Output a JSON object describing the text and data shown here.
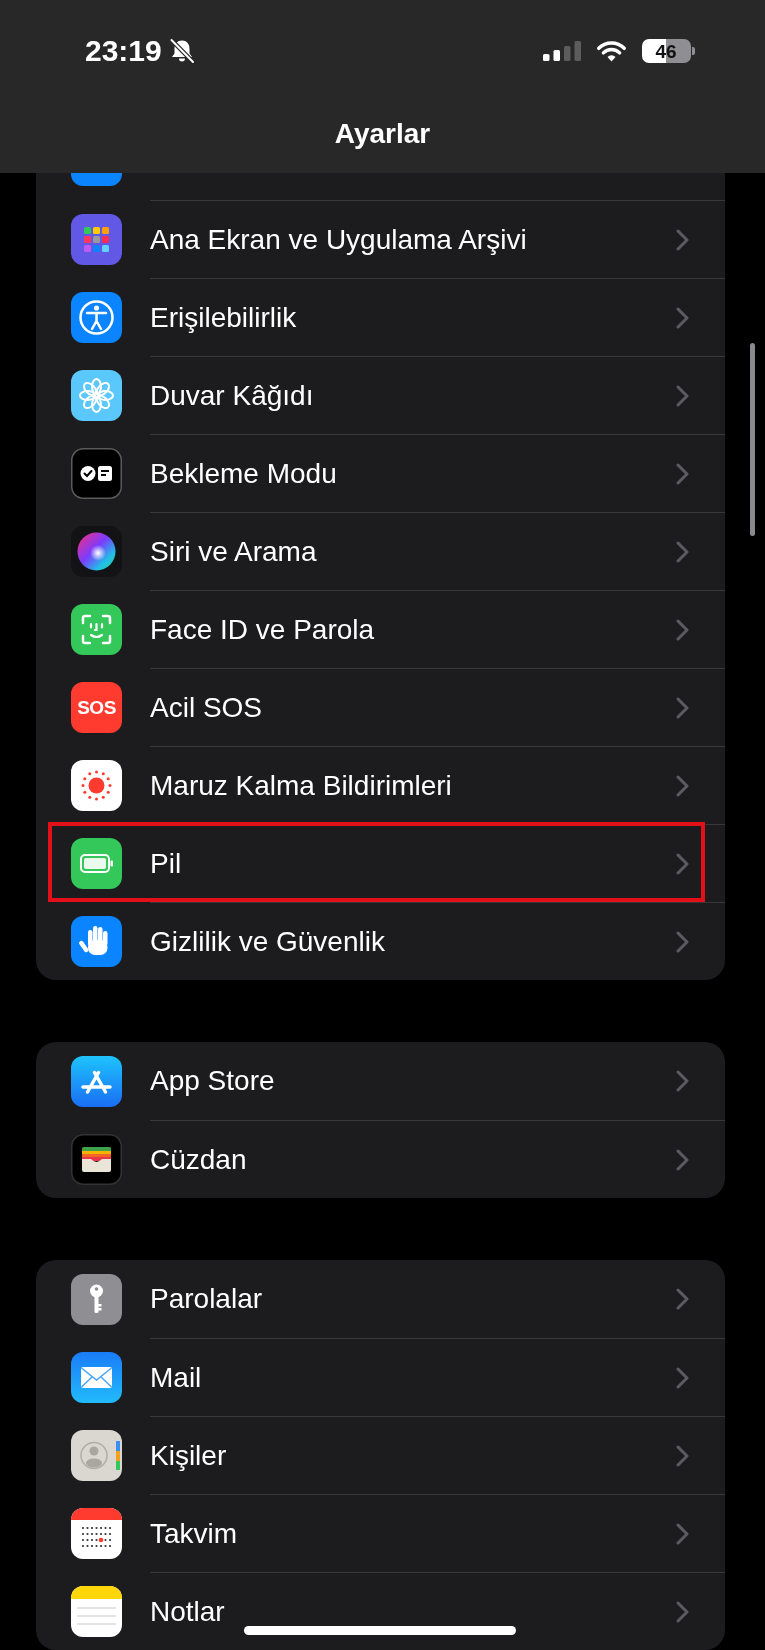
{
  "status_bar": {
    "time": "23:19",
    "silent": true,
    "battery": "46"
  },
  "navigation_bar": {
    "title": "Ayarlar"
  },
  "groups": [
    {
      "cut_off_above": true,
      "items": [
        {
          "label": "Ana Ekran ve Uygulama Arşivi",
          "highlighted": false
        },
        {
          "label": "Erişilebilirlik",
          "highlighted": false
        },
        {
          "label": "Duvar Kâğıdı",
          "highlighted": false
        },
        {
          "label": "Bekleme Modu",
          "highlighted": false
        },
        {
          "label": "Siri ve Arama",
          "highlighted": false
        },
        {
          "label": "Face ID ve Parola",
          "highlighted": false
        },
        {
          "label": "Acil SOS",
          "icon_text": "SOS",
          "highlighted": false
        },
        {
          "label": "Maruz Kalma Bildirimleri",
          "highlighted": false
        },
        {
          "label": "Pil",
          "highlighted": true
        },
        {
          "label": "Gizlilik ve Güvenlik",
          "highlighted": false
        }
      ]
    },
    {
      "cut_off_above": false,
      "items": [
        {
          "label": "App Store",
          "highlighted": false
        },
        {
          "label": "Cüzdan",
          "highlighted": false
        }
      ]
    },
    {
      "cut_off_above": false,
      "items": [
        {
          "label": "Parolalar",
          "highlighted": false
        },
        {
          "label": "Mail",
          "highlighted": false
        },
        {
          "label": "Kişiler",
          "highlighted": false
        },
        {
          "label": "Takvim",
          "highlighted": false
        },
        {
          "label": "Notlar",
          "highlighted": false
        }
      ]
    }
  ]
}
